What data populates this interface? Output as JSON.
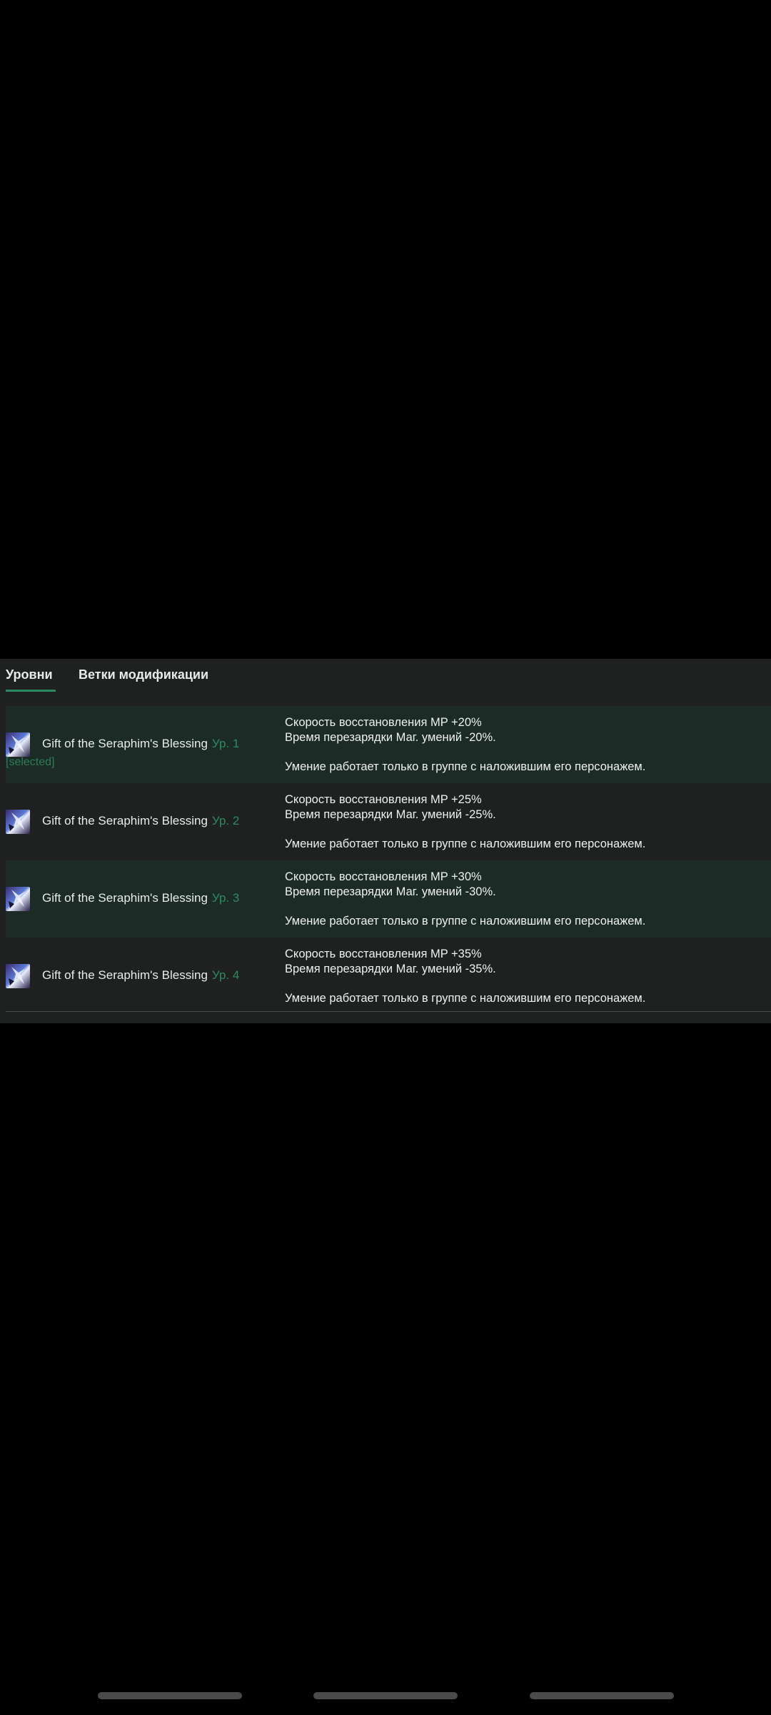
{
  "tabs": [
    {
      "label": "Уровни",
      "active": true
    },
    {
      "label": "Ветки модификации",
      "active": false
    }
  ],
  "accent_color": "#2b8a62",
  "levels": [
    {
      "icon": "seraphim-blessing-skill-icon",
      "name": "Gift of the Seraphim's Blessing",
      "level": "Ур. 1",
      "selected_label": "[selected]",
      "line1": "Скорость восстановления MP +20%",
      "line2": "Время перезарядки Маг. умений -20%.",
      "line3": "Умение работает только в группе с наложившим его персонажем."
    },
    {
      "icon": "seraphim-blessing-skill-icon",
      "name": "Gift of the Seraphim's Blessing",
      "level": "Ур. 2",
      "line1": "Скорость восстановления MP +25%",
      "line2": "Время перезарядки Маг. умений -25%.",
      "line3": "Умение работает только в группе с наложившим его персонажем."
    },
    {
      "icon": "seraphim-blessing-skill-icon",
      "name": "Gift of the Seraphim's Blessing",
      "level": "Ур. 3",
      "line1": "Скорость восстановления MP +30%",
      "line2": "Время перезарядки Маг. умений -30%.",
      "line3": "Умение работает только в группе с наложившим его персонажем."
    },
    {
      "icon": "seraphim-blessing-skill-icon",
      "name": "Gift of the Seraphim's Blessing",
      "level": "Ур. 4",
      "line1": "Скорость восстановления MP +35%",
      "line2": "Время перезарядки Маг. умений -35%.",
      "line3": "Умение работает только в группе с наложившим его персонажем."
    }
  ]
}
